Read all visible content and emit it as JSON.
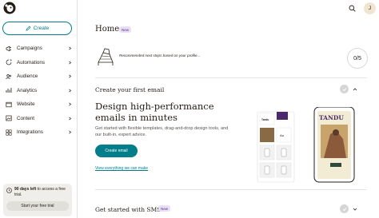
{
  "sidebar": {
    "create_label": "Create",
    "items": [
      {
        "label": "Campaigns",
        "icon": "campaigns-icon"
      },
      {
        "label": "Automations",
        "icon": "automations-icon"
      },
      {
        "label": "Audience",
        "icon": "audience-icon"
      },
      {
        "label": "Analytics",
        "icon": "analytics-icon"
      },
      {
        "label": "Website",
        "icon": "website-icon"
      },
      {
        "label": "Content",
        "icon": "content-icon"
      },
      {
        "label": "Integrations",
        "icon": "integrations-icon"
      }
    ],
    "trial": {
      "days_text": "90 days left",
      "text_rest": " to access a free trial.",
      "button_label": "Start your free trial"
    }
  },
  "header": {
    "avatar_initial": "J"
  },
  "main": {
    "title": "Home",
    "title_badge": "New",
    "recommendation_text": "Recommended next steps based on your profile...",
    "progress": "0/5",
    "section1_title": "Create your first email",
    "hero_title": "Design high-performance emails in minutes",
    "hero_desc": "Get started with flexible templates, drag-and-drop design tools, and our built-in, expert advice.",
    "primary_button": "Create email",
    "link_text": "View everything we can make",
    "illustration": {
      "brand": "TANDU",
      "small_brand": "Tandu",
      "aa": "Aa"
    },
    "section2_title": "Get started with SMS",
    "section2_badge": "New"
  },
  "colors": {
    "accent": "#017e89",
    "badge_bg": "#e8dff5",
    "badge_text": "#5b2d8c"
  }
}
